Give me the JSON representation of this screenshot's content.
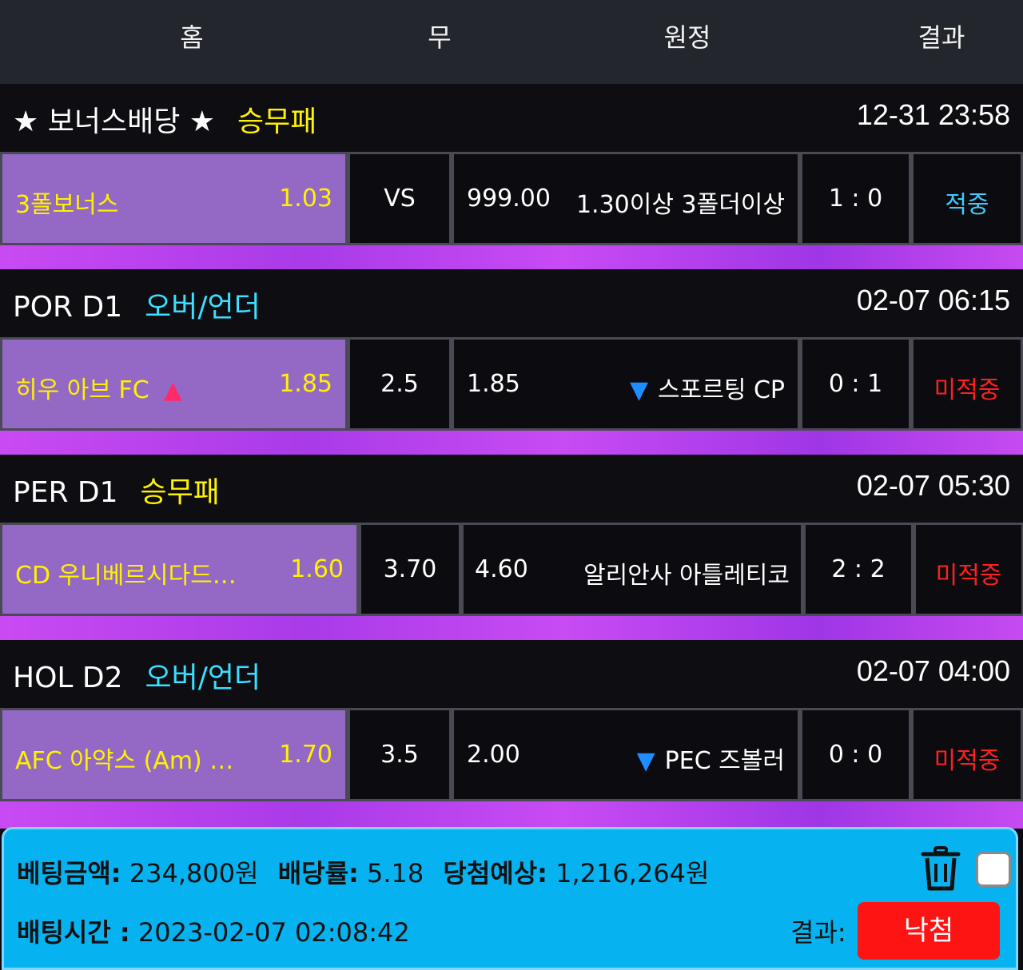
{
  "header": {
    "col_home": "홈",
    "col_draw": "무",
    "col_away": "원정",
    "col_result": "결과"
  },
  "games": [
    {
      "title_prefix": "★ 보너스배당 ★",
      "bet_type": "승무패",
      "datetime": "12-31 23:58",
      "home": "3폴보너스",
      "home_odds": "1.03",
      "home_arrow": "",
      "middle": "VS",
      "away_odds": "999.00",
      "away_arrow": "",
      "away": "1.30이상 3폴더이상",
      "score": "1 : 0",
      "result": "적중"
    },
    {
      "title_prefix": "POR D1",
      "bet_type": "오버/언더",
      "datetime": "02-07 06:15",
      "home": "히우 아브 FC",
      "home_odds": "1.85",
      "home_arrow": "▲",
      "middle": "2.5",
      "away_odds": "1.85",
      "away_arrow": "▼",
      "away": "스포르팅 CP",
      "score": "0 : 1",
      "result": "미적중"
    },
    {
      "title_prefix": "PER D1",
      "bet_type": "승무패",
      "datetime": "02-07 05:30",
      "home": "CD 우니베르시다드…",
      "home_odds": "1.60",
      "home_arrow": "",
      "middle": "3.70",
      "away_odds": "4.60",
      "away_arrow": "",
      "away": "알리안사 아틀레티코",
      "score": "2 : 2",
      "result": "미적중"
    },
    {
      "title_prefix": "HOL D2",
      "bet_type": "오버/언더",
      "datetime": "02-07 04:00",
      "home": "AFC 아약스 (Am) …",
      "home_odds": "1.70",
      "home_arrow": "",
      "middle": "3.5",
      "away_odds": "2.00",
      "away_arrow": "▼",
      "away": "PEC 즈볼러",
      "score": "0 : 0",
      "result": "미적중"
    }
  ],
  "footer": {
    "bet_amount_label": "베팅금액:",
    "bet_amount": "234,800원",
    "odds_label": "배당률:",
    "odds": "5.18",
    "expected_label": "당첨예상:",
    "expected": "1,216,264원",
    "bet_time_label": "배팅시간 :",
    "bet_time": "2023-02-07 02:08:42",
    "result_label": "결과:",
    "result_button": "낙첨"
  },
  "colors": {
    "home_cell": "#9469c6",
    "stripe": "#c94af2",
    "footer": "#06b2f0",
    "result_button": "#ff1414",
    "hit": "#3fc9ff",
    "miss": "#ff2020"
  },
  "icons": {
    "delete": "trash-icon",
    "select": "checkbox"
  }
}
